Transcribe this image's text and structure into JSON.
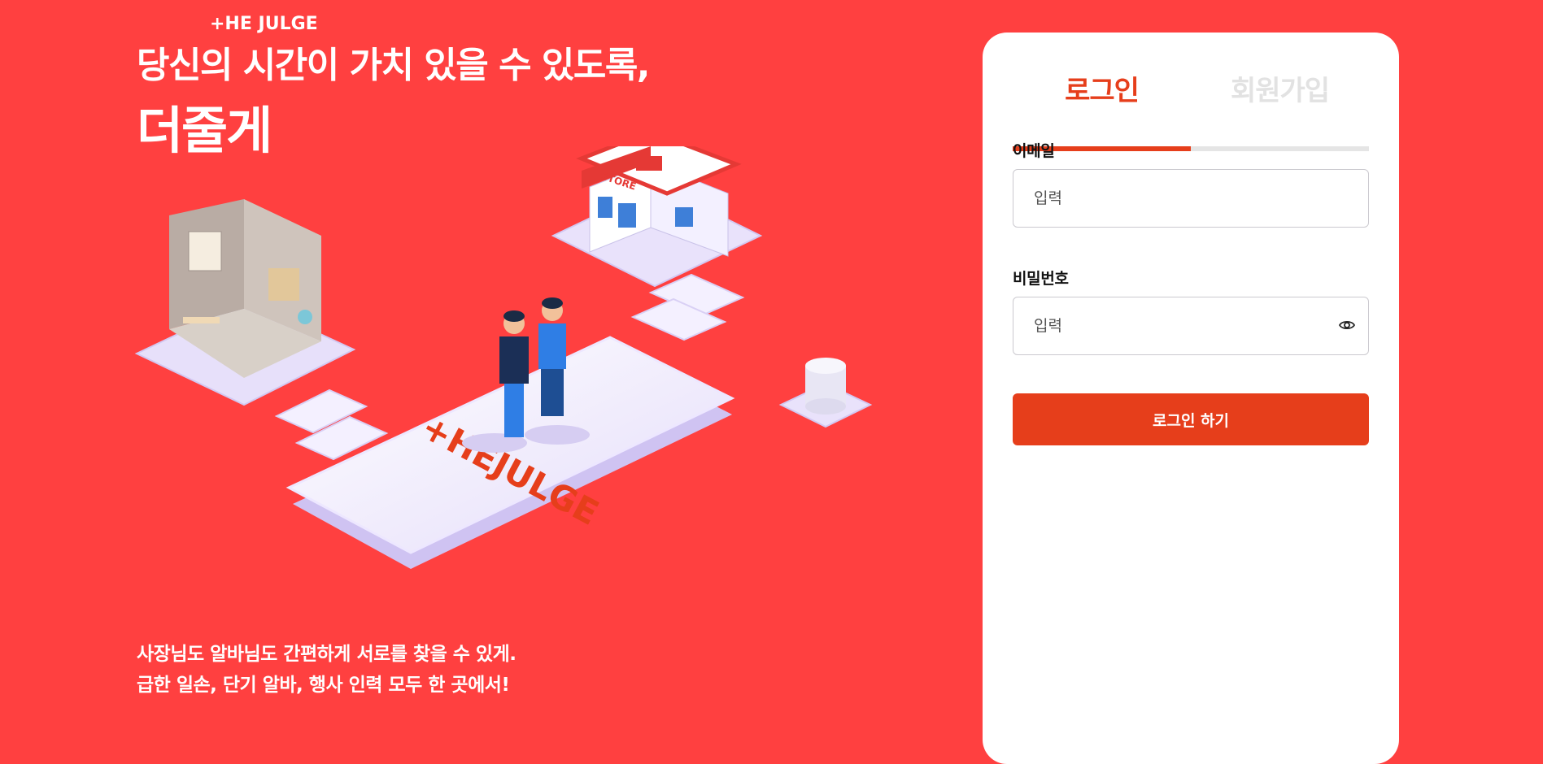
{
  "brand": {
    "logo_text": "+HE JULGE",
    "illustration_logo_text": "+HEJULGE",
    "store_sign": "STORE"
  },
  "hero": {
    "headline_line1": "당신의 시간이 가치 있을 수 있도록,",
    "headline_line2": "더줄게",
    "tagline_line1": "사장님도 알바님도 간편하게 서로를 찾을 수 있게.",
    "tagline_line2": "급한 일손, 단기 알바, 행사 인력 모두 한 곳에서!"
  },
  "auth": {
    "tabs": [
      {
        "label": "로그인",
        "active": true
      },
      {
        "label": "회원가입",
        "active": false
      }
    ],
    "email": {
      "label": "이메일",
      "placeholder": "입력",
      "value": ""
    },
    "password": {
      "label": "비밀번호",
      "placeholder": "입력",
      "value": "",
      "toggle_icon": "eye-icon"
    },
    "submit_label": "로그인 하기"
  },
  "colors": {
    "background": "#FF4040",
    "accent": "#E63E1B",
    "card": "#FFFFFF",
    "inactive_tab": "#E2E2E2"
  }
}
